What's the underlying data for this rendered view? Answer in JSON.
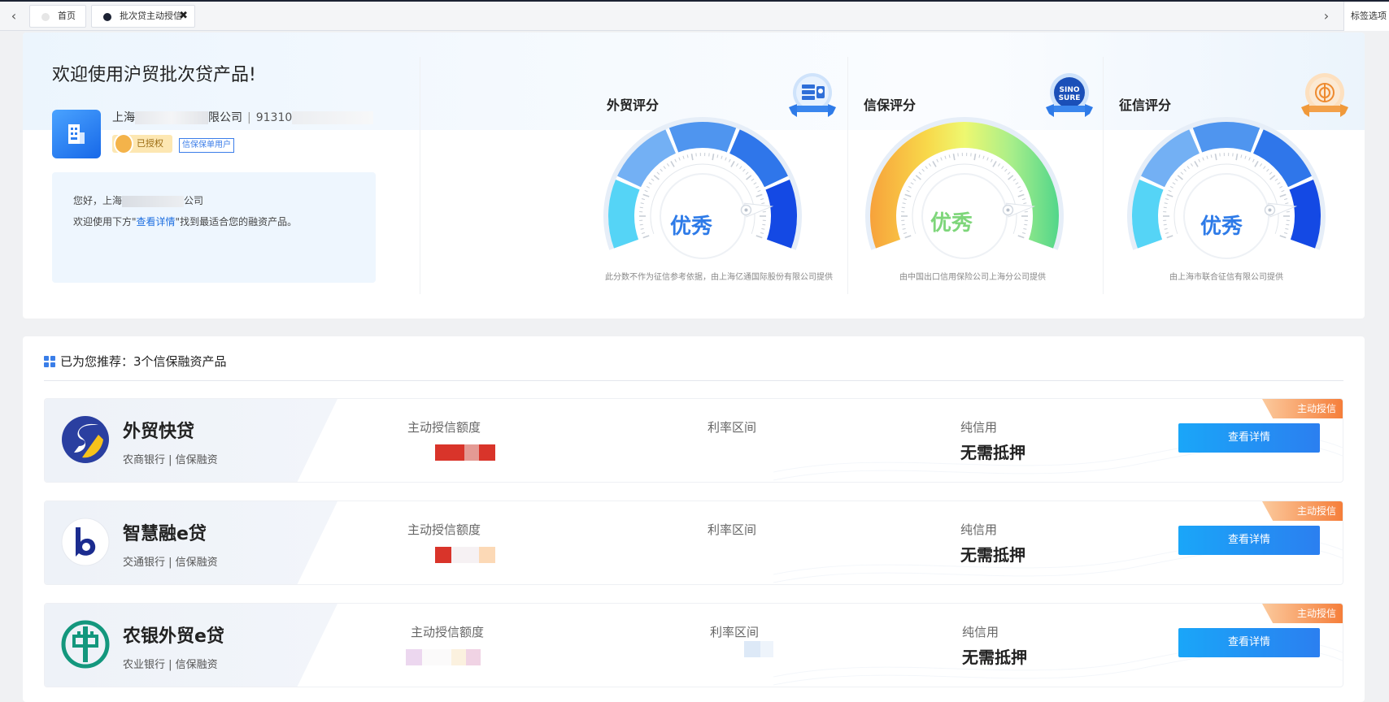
{
  "tabbar": {
    "tabs": [
      {
        "label": "首页",
        "dot_color": "#e6e6e6"
      },
      {
        "label": "批次贷主动授信",
        "dot_color": "#1c2233",
        "closable": true
      }
    ],
    "close_icon": "✖",
    "options_label": "标签选项"
  },
  "profile": {
    "welcome": "欢迎使用沪贸批次贷产品!",
    "company_prefix": "上海",
    "company_suffix": "限公司",
    "credit_code_prefix": "91310",
    "authorized": "已授权",
    "user_tag": "信保保单用户",
    "hello_prefix": "您好，上海",
    "hello_suffix": "公司",
    "guide_prefix": "欢迎使用下方\"",
    "guide_link": "查看详情",
    "guide_suffix": "\"找到最适合您的融资产品。"
  },
  "scores": [
    {
      "title": "外贸评分",
      "grade": "优秀",
      "note": "此分数不作为征信参考依据，由上海亿通国际股份有限公司提供",
      "style": "blue",
      "badge": "trade-badge-icon"
    },
    {
      "title": "信保评分",
      "grade": "优秀",
      "note": "由中国出口信用保险公司上海分公司提供",
      "style": "rainbow",
      "badge": "sinosure-badge-icon",
      "badge_text": "SINO SURE"
    },
    {
      "title": "征信评分",
      "grade": "优秀",
      "note": "由上海市联合征信有限公司提供",
      "style": "blue",
      "badge": "credit-badge-icon"
    }
  ],
  "recommend": {
    "heading": "已为您推荐：3个信保融资产品",
    "ribbon": "主动授信",
    "label_amount": "主动授信额度",
    "label_rate": "利率区间",
    "label_credit": "纯信用",
    "no_collateral": "无需抵押",
    "button": "查看详情",
    "products": [
      {
        "name": "外贸快贷",
        "bank": "农商银行 | 信保融资",
        "logo": "s-swirl-logo"
      },
      {
        "name": "智慧融e贷",
        "bank": "交通银行 | 信保融资",
        "logo": "bocom-logo"
      },
      {
        "name": "农银外贸e贷",
        "bank": "农业银行 | 信保融资",
        "logo": "abc-logo"
      }
    ]
  },
  "colors": {
    "accent": "#1e6fe0",
    "button": "#1aa6f8",
    "ribbon": "#f57e3a",
    "grade_blue": "#2e7be8",
    "grade_green": "#7ed67a"
  }
}
